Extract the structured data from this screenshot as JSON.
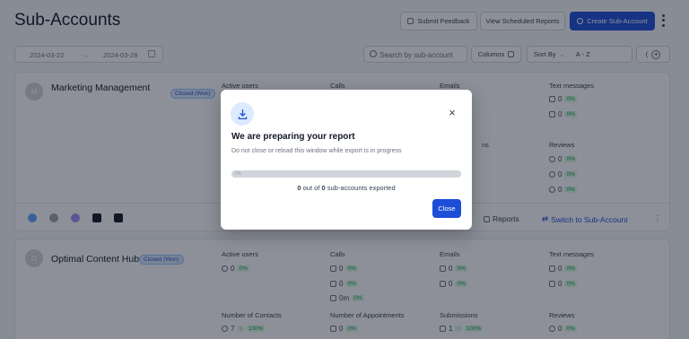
{
  "page": {
    "title": "Sub-Accounts"
  },
  "header": {
    "submit_feedback": "Submit Feedback",
    "view_scheduled": "View Scheduled Reports",
    "create_sub_account": "Create Sub-Account"
  },
  "filters": {
    "date_start": "2024-03-22",
    "date_arrow": "→",
    "date_end": "2024-03-28",
    "search_placeholder": "Search by sub-account",
    "columns": "Columns",
    "sort_by": "Sort By",
    "sort_value": "A - Z"
  },
  "cards": [
    {
      "initial": "M",
      "name": "Marketing Management",
      "badge": "Closed (Won)",
      "sections": {
        "active_users": "Active users",
        "calls": "Calls",
        "emails": "Emails",
        "text_messages": "Text messages",
        "submissions_partial": "ns",
        "reviews": "Reviews"
      },
      "text_messages": [
        {
          "value": "0",
          "pct": "0%"
        },
        {
          "value": "0",
          "pct": "0%"
        }
      ],
      "reviews": [
        {
          "value": "0",
          "pct": "0%"
        },
        {
          "value": "0",
          "pct": "0%"
        },
        {
          "value": "0",
          "pct": "0%"
        }
      ],
      "actions": {
        "reports": "Reports",
        "switch": "Switch to Sub-Account"
      }
    },
    {
      "initial": "O",
      "name": "Optimal Content Hub",
      "badge": "Closed (Won)",
      "sections": {
        "active_users": "Active users",
        "calls": "Calls",
        "emails": "Emails",
        "text_messages": "Text messages",
        "contacts": "Number of Contacts",
        "appointments": "Number of Appointments",
        "submissions": "Submissions",
        "reviews": "Reviews"
      },
      "active_users": {
        "value": "0",
        "pct": "0%"
      },
      "calls": [
        {
          "value": "0",
          "pct": "0%"
        },
        {
          "value": "0",
          "pct": "0%"
        },
        {
          "value": "0m",
          "pct": "0%"
        }
      ],
      "emails": [
        {
          "value": "0",
          "pct": "0%"
        },
        {
          "value": "0",
          "pct": "0%"
        }
      ],
      "text_messages": [
        {
          "value": "0",
          "pct": "0%"
        },
        {
          "value": "0",
          "pct": "0%"
        }
      ],
      "contacts": {
        "value": "7",
        "pct": "100%"
      },
      "appointments": {
        "value": "0",
        "pct": "0%"
      },
      "submissions": {
        "value": "1",
        "pct": "100%"
      },
      "reviews": {
        "value": "0",
        "pct": "0%"
      }
    }
  ],
  "modal": {
    "title": "We are preparing your report",
    "subtitle": "Do not close or reload this window while export is in progress",
    "progress_label": "0%",
    "progress_fraction": 0,
    "progress_count": "0",
    "progress_mid": " out of ",
    "progress_total": "0",
    "progress_suffix": " sub-accounts exported",
    "close": "Close"
  },
  "colors": {
    "accent": "#1d4ed8",
    "success": "#16a34a"
  }
}
